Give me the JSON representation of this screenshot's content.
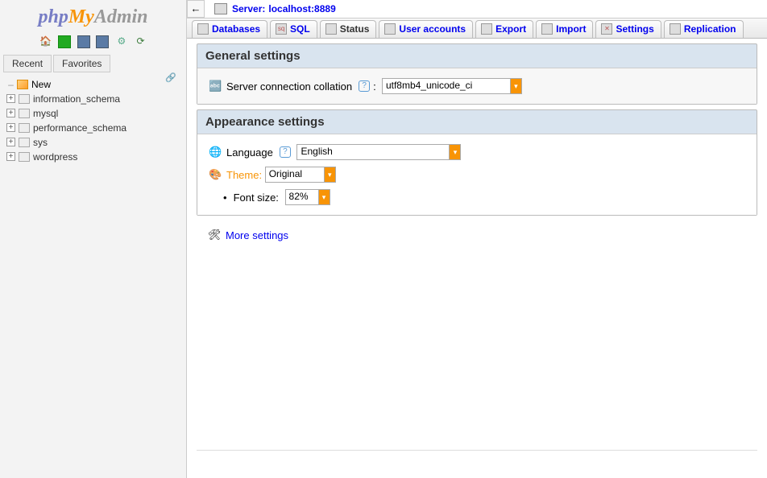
{
  "logo": {
    "php": "php",
    "my": "My",
    "admin": "Admin"
  },
  "sidebar_tabs": {
    "recent": "Recent",
    "favorites": "Favorites"
  },
  "tree": {
    "new_label": "New",
    "dbs": [
      "information_schema",
      "mysql",
      "performance_schema",
      "sys",
      "wordpress"
    ]
  },
  "breadcrumb": {
    "label": "Server:",
    "value": "localhost:8889"
  },
  "tabs": {
    "databases": "Databases",
    "sql": "SQL",
    "status": "Status",
    "users": "User accounts",
    "export": "Export",
    "import": "Import",
    "settings": "Settings",
    "replication": "Replication"
  },
  "general": {
    "title": "General settings",
    "collation_label": "Server connection collation",
    "collation_value": "utf8mb4_unicode_ci"
  },
  "appearance": {
    "title": "Appearance settings",
    "language_label": "Language",
    "language_value": "English",
    "theme_label": "Theme:",
    "theme_value": "Original",
    "fontsize_label": "Font size:",
    "fontsize_value": "82%"
  },
  "more_settings": "More settings"
}
